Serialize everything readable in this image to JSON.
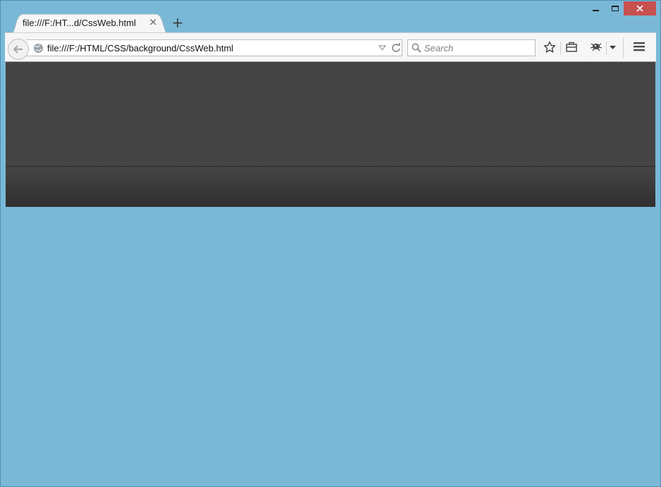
{
  "tab": {
    "title": "file:///F:/HT...d/CssWeb.html",
    "close_glyph": "×"
  },
  "new_tab_glyph": "+",
  "address_bar": {
    "url": "file:///F:/HTML/CSS/background/CssWeb.html"
  },
  "search": {
    "placeholder": "Search"
  },
  "colors": {
    "window_frame": "#7ab8d8",
    "close_button": "#c75050",
    "header_dark": "#464646",
    "band_dark": "#333333",
    "page_body": "#7ab8d8"
  },
  "icons": {
    "back": "back-arrow-icon",
    "site": "globe-icon",
    "bookmark": "star-icon",
    "reading_list": "briefcase-icon",
    "extension": "bug-icon",
    "menu": "hamburger-menu-icon"
  }
}
